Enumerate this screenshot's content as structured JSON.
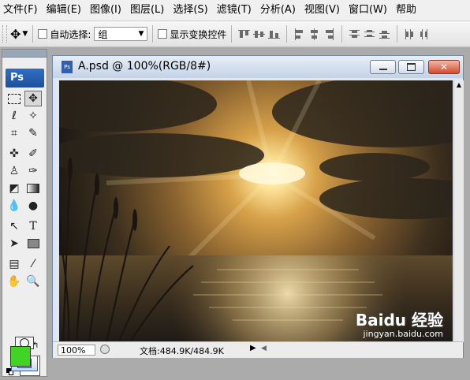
{
  "menu": [
    "文件(F)",
    "编辑(E)",
    "图像(I)",
    "图层(L)",
    "选择(S)",
    "滤镜(T)",
    "分析(A)",
    "视图(V)",
    "窗口(W)",
    "帮助"
  ],
  "options": {
    "auto_select_label": "自动选择:",
    "auto_select_value": "组",
    "show_transform_label": "显示变换控件"
  },
  "toolbox": {
    "logo": "Ps",
    "foreground": "#41d425",
    "background": "#ffffff"
  },
  "document": {
    "title": "A.psd @ 100%(RGB/8#)",
    "zoom": "100%",
    "doc_info": "文档:484.9K/484.9K"
  },
  "watermark": {
    "text": "Baidu 经验",
    "url": "jingyan.baidu.com"
  }
}
